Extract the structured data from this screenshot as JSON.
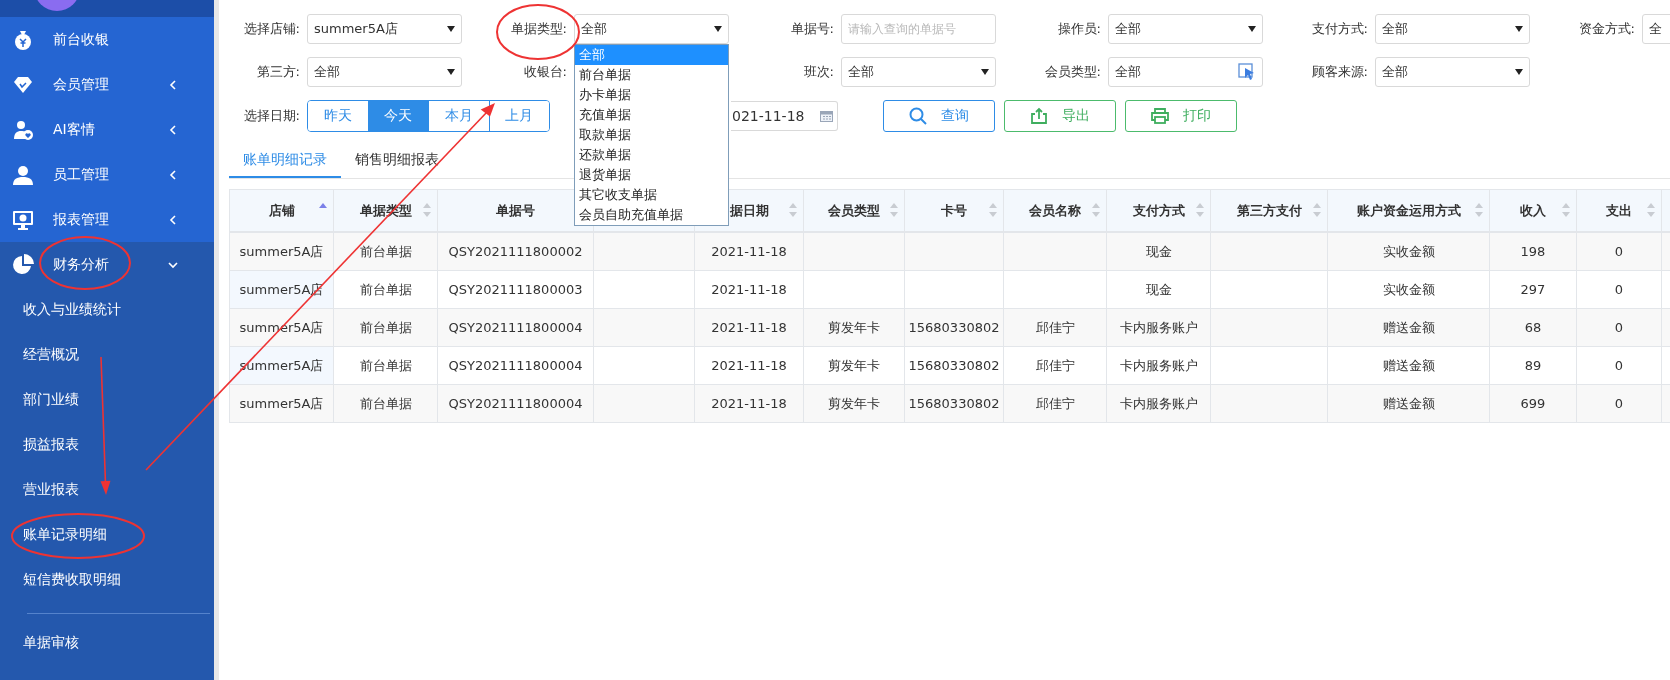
{
  "sidebar": {
    "items": [
      {
        "label": "前台收银",
        "has_submenu": false
      },
      {
        "label": "会员管理",
        "has_submenu": true,
        "expanded": false
      },
      {
        "label": "AI客情",
        "has_submenu": true,
        "expanded": false
      },
      {
        "label": "员工管理",
        "has_submenu": true,
        "expanded": false
      },
      {
        "label": "报表管理",
        "has_submenu": true,
        "expanded": false
      },
      {
        "label": "财务分析",
        "has_submenu": true,
        "expanded": true,
        "children": [
          {
            "label": "收入与业绩统计"
          },
          {
            "label": "经营概况"
          },
          {
            "label": "部门业绩"
          },
          {
            "label": "损益报表"
          },
          {
            "label": "营业报表"
          },
          {
            "label": "账单记录明细"
          },
          {
            "label": "短信费收取明细"
          }
        ]
      }
    ],
    "footer_items": [
      {
        "label": "单据审核"
      }
    ]
  },
  "filters": {
    "rows": [
      [
        {
          "label": "选择店铺:",
          "kind": "select",
          "value": "summer5A店"
        },
        {
          "label": "单据类型:",
          "kind": "select",
          "value": "全部",
          "options": [
            {
              "label": "全部",
              "selected": true
            },
            {
              "label": "前台单据",
              "selected": false
            },
            {
              "label": "办卡单据",
              "selected": false
            },
            {
              "label": "充值单据",
              "selected": false
            },
            {
              "label": "取款单据",
              "selected": false
            },
            {
              "label": "还款单据",
              "selected": false
            },
            {
              "label": "退货单据",
              "selected": false
            },
            {
              "label": "其它收支单据",
              "selected": false
            },
            {
              "label": "会员自助充值单据",
              "selected": false
            }
          ]
        },
        {
          "label": "单据号:",
          "kind": "input",
          "placeholder": "请输入查询的单据号"
        },
        {
          "label": "操作员:",
          "kind": "select",
          "value": "全部"
        },
        {
          "label": "支付方式:",
          "kind": "select",
          "value": "全部"
        },
        {
          "label": "资金方式:",
          "kind": "select_cut",
          "value": "全"
        }
      ],
      [
        {
          "label": "第三方:",
          "kind": "select",
          "value": "全部"
        },
        {
          "label": "收银台:",
          "kind": "covered"
        },
        {
          "label": "班次:",
          "kind": "select",
          "value": "全部"
        },
        {
          "label": "会员类型:",
          "kind": "picker",
          "value": "全部"
        },
        {
          "label": "顾客来源:",
          "kind": "select",
          "value": "全部"
        }
      ]
    ],
    "date_label": "选择日期:",
    "date_range": [
      {
        "label": "昨天",
        "selected": false
      },
      {
        "label": "今天",
        "selected": true
      },
      {
        "label": "本月",
        "selected": false
      },
      {
        "label": "上月",
        "selected": false
      }
    ],
    "date_field": {
      "value": "021-11-18"
    },
    "actions": [
      {
        "label": "查询",
        "kind": "primary"
      },
      {
        "label": "导出",
        "kind": "success"
      },
      {
        "label": "打印",
        "kind": "success"
      }
    ]
  },
  "tabs": [
    {
      "label": "账单明细记录",
      "selected": true
    },
    {
      "label": "销售明细报表",
      "selected": false
    }
  ],
  "table": {
    "columns": [
      {
        "label": "店铺",
        "sortable": true,
        "sorted_asc": true
      },
      {
        "label": "单据类型",
        "sortable": true,
        "sorted_asc": false
      },
      {
        "label": "单据号"
      },
      {},
      {
        "label": "据日期",
        "sortable": true,
        "sorted_asc": false
      },
      {
        "label": "会员类型",
        "sortable": true,
        "sorted_asc": false
      },
      {
        "label": "卡号",
        "sortable": true,
        "sorted_asc": false
      },
      {
        "label": "会员名称",
        "sortable": true,
        "sorted_asc": false
      },
      {
        "label": "支付方式",
        "sortable": true,
        "sorted_asc": false
      },
      {
        "label": "第三方支付",
        "sortable": true,
        "sorted_asc": false
      },
      {
        "label": "账户资金运用方式",
        "sortable": true,
        "sorted_asc": false
      },
      {
        "label": "收入",
        "sortable": true,
        "sorted_asc": false
      },
      {
        "label": "支出",
        "sortable": true,
        "sorted_asc": false
      }
    ],
    "rows": [
      {
        "cells": [
          "summer5A店",
          "前台单据",
          "QSY2021111800002",
          null,
          "2021-11-18",
          null,
          null,
          null,
          "现金",
          null,
          "实收金额",
          "198",
          "0"
        ]
      },
      {
        "cells": [
          "summer5A店",
          "前台单据",
          "QSY2021111800003",
          null,
          "2021-11-18",
          null,
          null,
          null,
          "现金",
          null,
          "实收金额",
          "297",
          "0"
        ]
      },
      {
        "cells": [
          "summer5A店",
          "前台单据",
          "QSY2021111800004",
          null,
          "2021-11-18",
          "剪发年卡",
          "15680330802",
          "邱佳宁",
          "卡内服务账户",
          null,
          "赠送金额",
          "68",
          "0"
        ]
      },
      {
        "cells": [
          "summer5A店",
          "前台单据",
          "QSY2021111800004",
          null,
          "2021-11-18",
          "剪发年卡",
          "15680330802",
          "邱佳宁",
          "卡内服务账户",
          null,
          "赠送金额",
          "89",
          "0"
        ]
      },
      {
        "cells": [
          "summer5A店",
          "前台单据",
          "QSY2021111800004",
          null,
          "2021-11-18",
          "剪发年卡",
          "15680330802",
          "邱佳宁",
          "卡内服务账户",
          null,
          "赠送金额",
          "699",
          "0"
        ]
      }
    ]
  }
}
